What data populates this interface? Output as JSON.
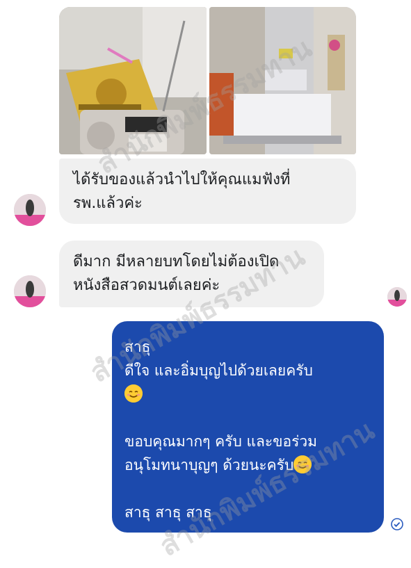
{
  "photos": [
    {
      "name": "photo-book-radio"
    },
    {
      "name": "photo-hospital-bed"
    }
  ],
  "messages": {
    "received_1": {
      "lines": [
        "ได้รับของแล้วนำไปให้คุณแมฟังที่",
        "รพ.แล้วค่ะ"
      ]
    },
    "received_2": {
      "lines": [
        "ดีมาก มีหลายบทโดยไม่ต้องเปิด",
        "หนังสือสวดมนต์เลยค่ะ"
      ]
    },
    "sent_1": {
      "lines": [
        "สาธุ",
        "ดีใจ และอิ่มบุญไปด้วยเลยครับ",
        "ขอบคุณมากๆ ครับ และขอร่วม",
        "อนุโมทนาบุญๆ ด้วยนะครับ",
        "สาธุ สาธุ สาธุ"
      ]
    }
  },
  "watermark": "สำนักพิมพ์ธรรมทาน",
  "colors": {
    "sent_bubble": "#1c4aad",
    "received_bubble": "#f0f0f0",
    "read_receipt": "#2a5bbf"
  },
  "icons": {
    "read_receipt": "check-circle-icon",
    "emoji": "smiling-face-icon"
  }
}
